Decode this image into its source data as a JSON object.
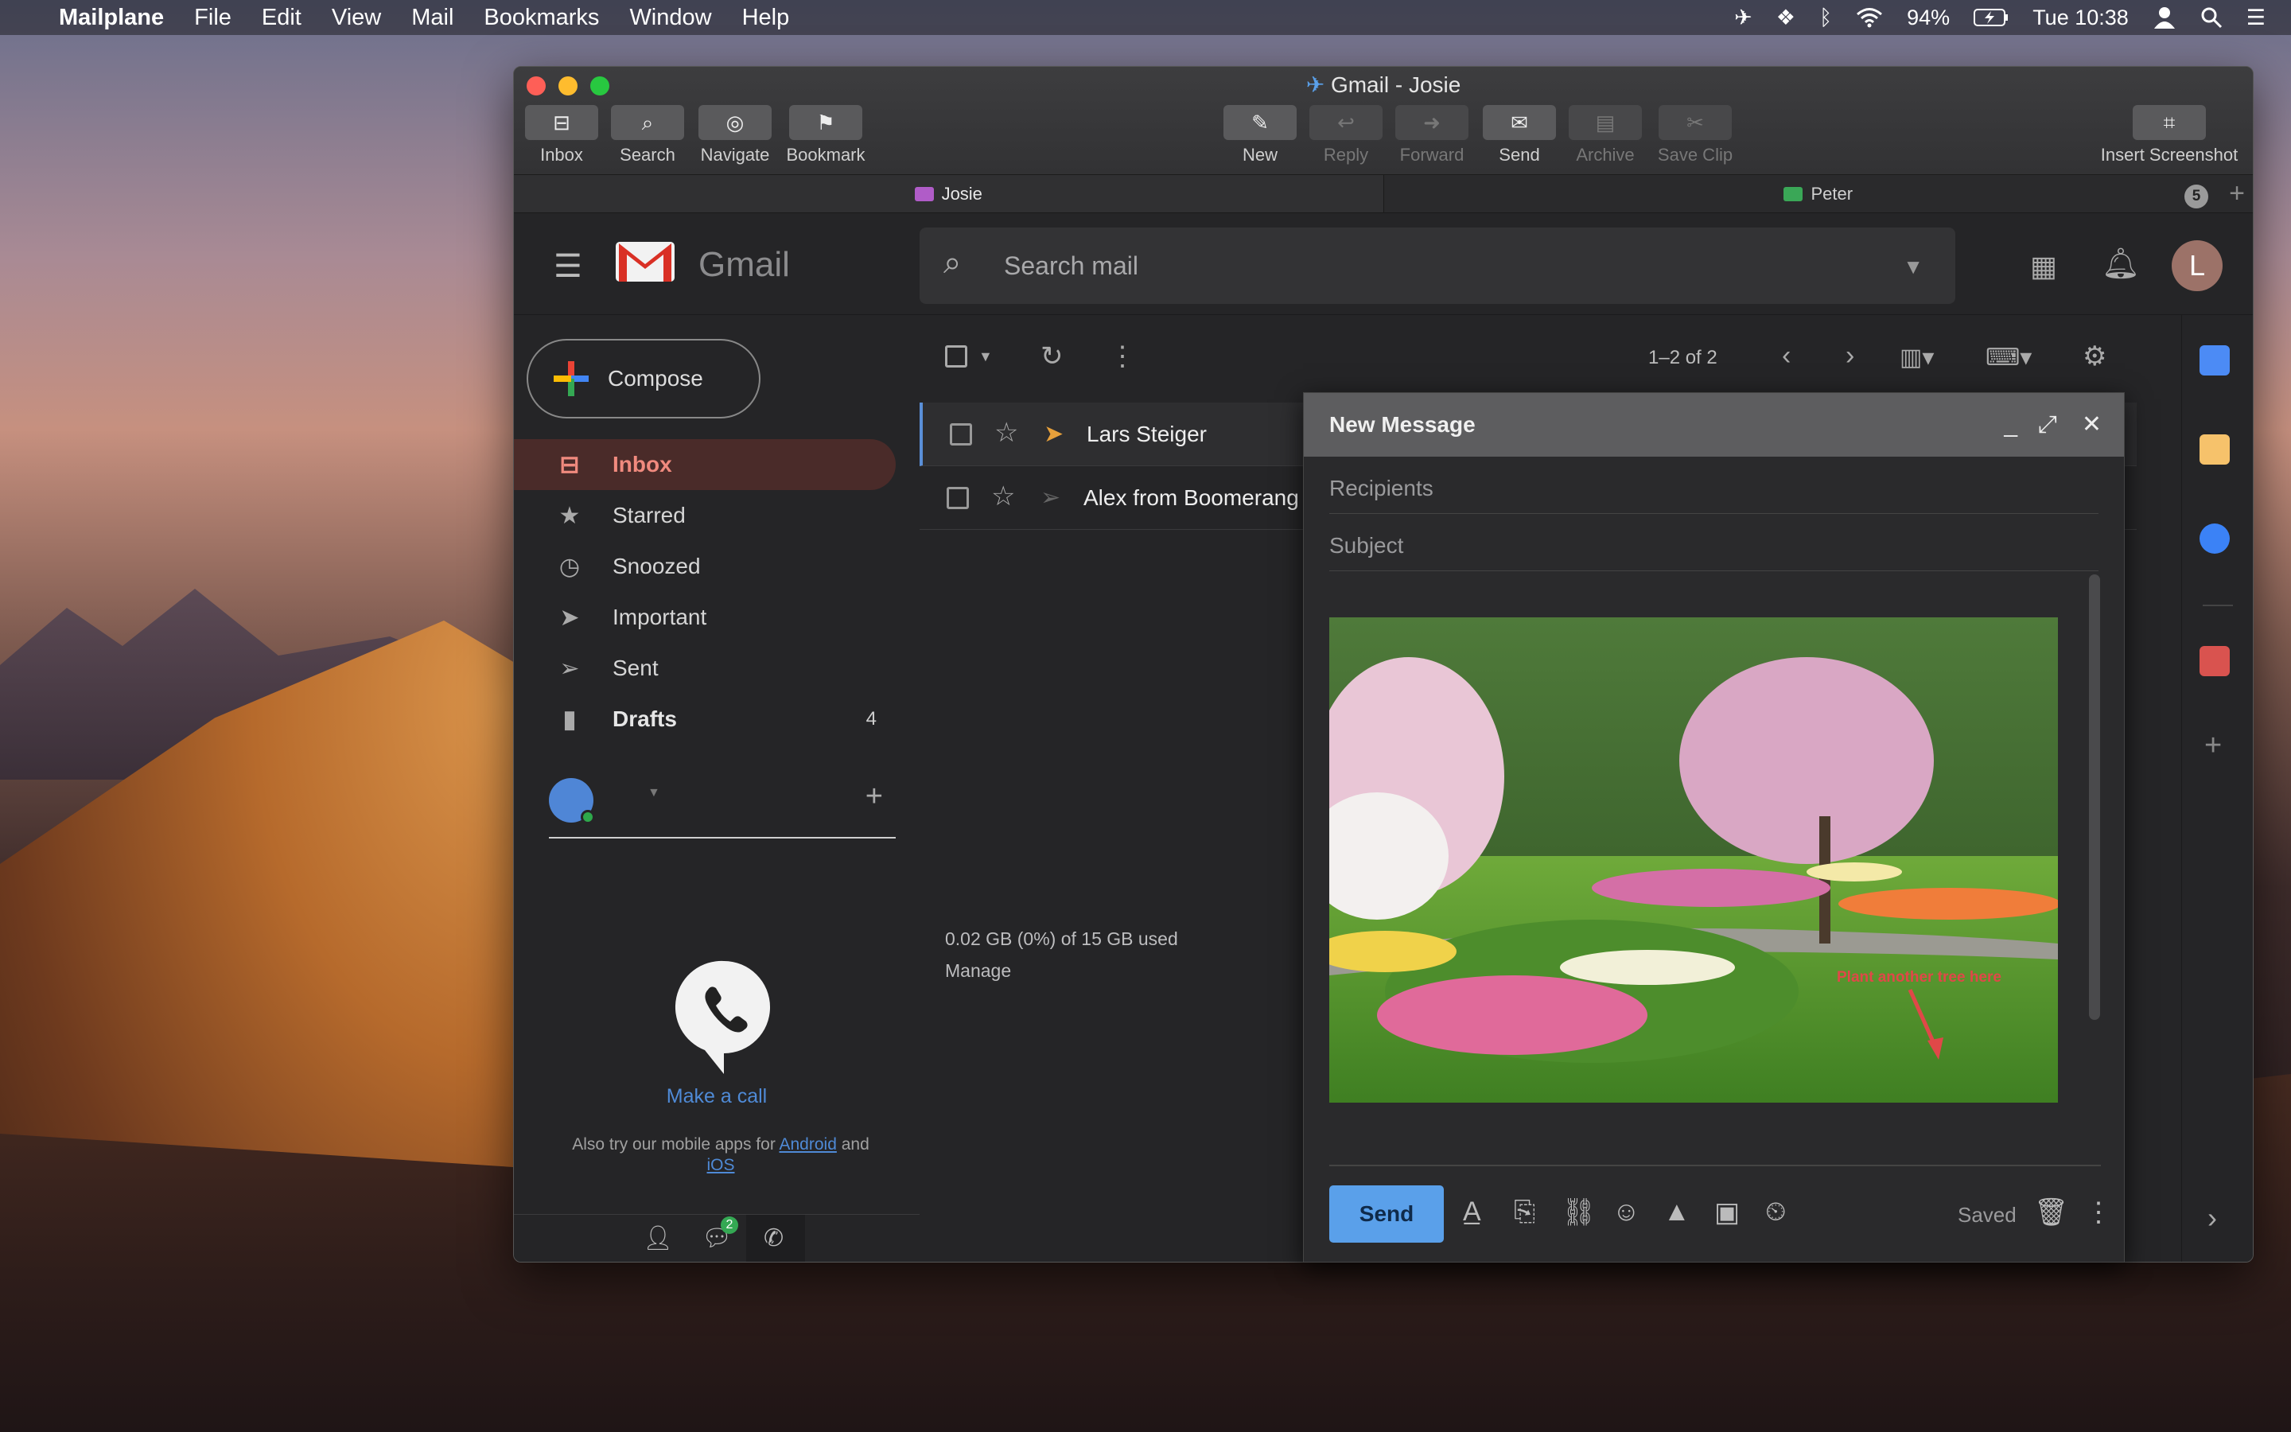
{
  "menubar": {
    "app": "Mailplane",
    "items": [
      "File",
      "Edit",
      "View",
      "Mail",
      "Bookmarks",
      "Window",
      "Help"
    ],
    "battery": "94%",
    "clock": "Tue 10:38"
  },
  "window": {
    "title": "Gmail - Josie",
    "toolbar_left": [
      "Inbox",
      "Search",
      "Navigate",
      "Bookmark"
    ],
    "toolbar_center": [
      "New",
      "Reply",
      "Forward",
      "Send",
      "Archive",
      "Save Clip"
    ],
    "toolbar_right": "Insert Screenshot",
    "tabs": [
      {
        "label": "Josie",
        "color": "#b05cc8"
      },
      {
        "label": "Peter",
        "color": "#3aa757"
      }
    ],
    "tab_count": "5"
  },
  "gmail": {
    "wordmark": "Gmail",
    "search_placeholder": "Search mail",
    "avatar_letter": "L",
    "compose_label": "Compose",
    "nav": [
      {
        "label": "Inbox",
        "icon": "inbox-icon"
      },
      {
        "label": "Starred",
        "icon": "star-icon"
      },
      {
        "label": "Snoozed",
        "icon": "clock-icon"
      },
      {
        "label": "Important",
        "icon": "important-icon"
      },
      {
        "label": "Sent",
        "icon": "send-icon"
      },
      {
        "label": "Drafts",
        "icon": "draft-icon",
        "count": "4"
      }
    ],
    "pager": "1–2 of 2",
    "emails": [
      {
        "sender": "Lars Steiger",
        "important": true
      },
      {
        "sender": "Alex from Boomerang",
        "important": false
      }
    ],
    "storage_line": "0.02 GB (0%) of 15 GB used",
    "manage": "Manage",
    "make_call": "Make a call",
    "mobile_note_prefix": "Also try our mobile apps for",
    "android": "Android",
    "and": "and",
    "ios": "iOS",
    "chat_badge": "2"
  },
  "compose": {
    "title": "New Message",
    "recipients_placeholder": "Recipients",
    "subject_placeholder": "Subject",
    "photo_annotation": "Plant another tree here",
    "send_label": "Send",
    "saved_label": "Saved"
  }
}
